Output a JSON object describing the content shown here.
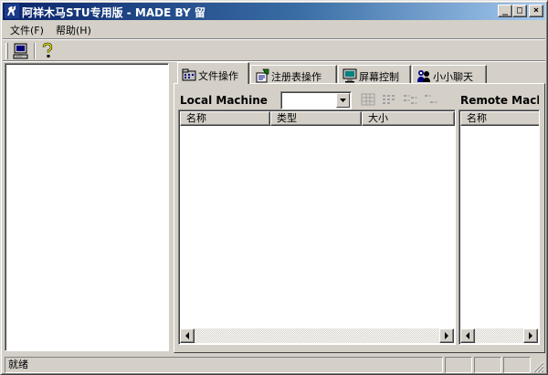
{
  "window": {
    "title": "阿祥木马STU专用版 - MADE BY 留",
    "minimize_glyph": "_",
    "maximize_glyph": "□",
    "close_glyph": "×"
  },
  "menu": {
    "file": "文件(F)",
    "help": "帮助(H)"
  },
  "toolbar": {
    "buttons": [
      {
        "icon": "computer-icon"
      },
      {
        "icon": "question-mark-icon"
      }
    ]
  },
  "tabs": [
    {
      "label": "文件操作",
      "icon": "file-folder-icon",
      "active": true
    },
    {
      "label": "注册表操作",
      "icon": "registry-icon",
      "active": false
    },
    {
      "label": "屏幕控制",
      "icon": "monitor-icon",
      "active": false
    },
    {
      "label": "小小聊天",
      "icon": "chat-people-icon",
      "active": false
    }
  ],
  "local": {
    "title": "Local Machine",
    "columns": [
      "名称",
      "类型",
      "大小"
    ],
    "view_icons": [
      "large-icons-view-icon",
      "small-icons-view-icon",
      "list-view-icon",
      "details-view-icon"
    ]
  },
  "remote": {
    "title": "Remote Machine",
    "columns": [
      "名称"
    ]
  },
  "status": {
    "text": "就绪"
  },
  "colors": {
    "face": "#d4d0c8",
    "title_start": "#0a246a",
    "title_end": "#a6caf0"
  }
}
